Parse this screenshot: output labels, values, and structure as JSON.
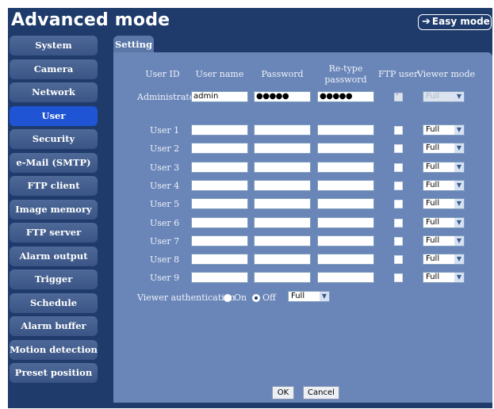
{
  "app": {
    "title": "Advanced mode",
    "easy_mode_label": "Easy mode"
  },
  "sidebar": {
    "items": [
      {
        "label": "System"
      },
      {
        "label": "Camera"
      },
      {
        "label": "Network"
      },
      {
        "label": "User",
        "active": true
      },
      {
        "label": "Security"
      },
      {
        "label": "e-Mail (SMTP)"
      },
      {
        "label": "FTP client"
      },
      {
        "label": "Image memory"
      },
      {
        "label": "FTP server"
      },
      {
        "label": "Alarm output"
      },
      {
        "label": "Trigger"
      },
      {
        "label": "Schedule"
      },
      {
        "label": "Alarm buffer"
      },
      {
        "label": "Motion detection"
      },
      {
        "label": "Preset position"
      }
    ]
  },
  "tab": {
    "label": "Setting"
  },
  "table": {
    "headers": {
      "user_id": "User ID",
      "user_name": "User name",
      "password": "Password",
      "retype_line1": "Re-type",
      "retype_line2": "password",
      "ftp_user": "FTP user",
      "viewer_mode": "Viewer mode"
    },
    "admin": {
      "label": "Administrator",
      "user_name": "admin",
      "password": "●●●●●",
      "retype": "●●●●●",
      "ftp_user": true,
      "viewer_mode": "Full"
    },
    "users": [
      {
        "label": "User 1",
        "user_name": "",
        "password": "",
        "retype": "",
        "viewer_mode": "Full"
      },
      {
        "label": "User 2",
        "user_name": "",
        "password": "",
        "retype": "",
        "viewer_mode": "Full"
      },
      {
        "label": "User 3",
        "user_name": "",
        "password": "",
        "retype": "",
        "viewer_mode": "Full"
      },
      {
        "label": "User 4",
        "user_name": "",
        "password": "",
        "retype": "",
        "viewer_mode": "Full"
      },
      {
        "label": "User 5",
        "user_name": "",
        "password": "",
        "retype": "",
        "viewer_mode": "Full"
      },
      {
        "label": "User 6",
        "user_name": "",
        "password": "",
        "retype": "",
        "viewer_mode": "Full"
      },
      {
        "label": "User 7",
        "user_name": "",
        "password": "",
        "retype": "",
        "viewer_mode": "Full"
      },
      {
        "label": "User 8",
        "user_name": "",
        "password": "",
        "retype": "",
        "viewer_mode": "Full"
      },
      {
        "label": "User 9",
        "user_name": "",
        "password": "",
        "retype": "",
        "viewer_mode": "Full"
      }
    ]
  },
  "viewer_auth": {
    "label": "Viewer authentication",
    "on_label": "On",
    "off_label": "Off",
    "selected": "Off",
    "mode": "Full"
  },
  "buttons": {
    "ok": "OK",
    "cancel": "Cancel"
  }
}
